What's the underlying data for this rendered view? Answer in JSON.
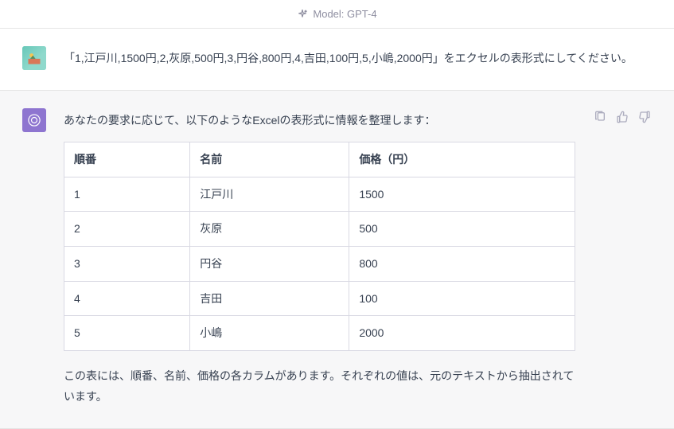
{
  "header": {
    "model_label": "Model: GPT-4"
  },
  "user_message": {
    "text": "「1,江戸川,1500円,2,灰原,500円,3,円谷,800円,4,吉田,100円,5,小嶋,2000円」をエクセルの表形式にしてください。"
  },
  "assistant_message": {
    "intro": "あなたの要求に応じて、以下のようなExcelの表形式に情報を整理します：",
    "footnote": "この表には、順番、名前、価格の各カラムがあります。それぞれの値は、元のテキストから抽出されています。"
  },
  "table": {
    "headers": [
      "順番",
      "名前",
      "価格（円）"
    ],
    "rows": [
      [
        "1",
        "江戸川",
        "1500"
      ],
      [
        "2",
        "灰原",
        "500"
      ],
      [
        "3",
        "円谷",
        "800"
      ],
      [
        "4",
        "吉田",
        "100"
      ],
      [
        "5",
        "小嶋",
        "2000"
      ]
    ]
  },
  "icons": {
    "sparkle": "sparkle-icon",
    "clipboard": "clipboard-icon",
    "thumbs_up": "thumbs-up-icon",
    "thumbs_down": "thumbs-down-icon",
    "openai": "openai-logo-icon"
  }
}
